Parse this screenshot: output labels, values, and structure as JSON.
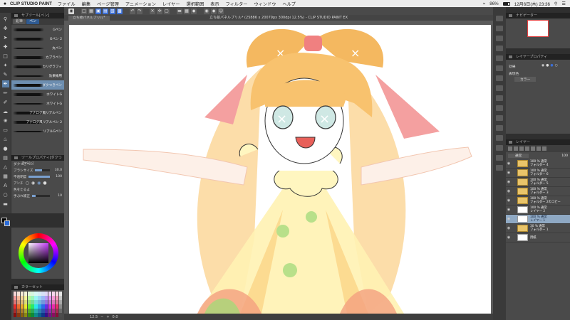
{
  "menubar": {
    "app_name": "CLIP STUDIO PAINT",
    "items": [
      "ファイル",
      "編集",
      "ページ管理",
      "アニメーション",
      "レイヤー",
      "選択範囲",
      "表示",
      "フィルター",
      "ウィンドウ",
      "ヘルプ"
    ],
    "battery": "86%",
    "clock": "12月6日(木) 23:36"
  },
  "document": {
    "tab_name": "立ち絵パネルプリル*",
    "title": "立ち絵パネルプリル* (25886 x 20079px 300dpi 12.5%) - CLIP STUDIO PAINT EX",
    "zoom": "12.5",
    "angle": "0.0"
  },
  "subtool": {
    "panel_title": "サブツール[ペン]",
    "tabs": [
      "鉛筆",
      "ペン"
    ],
    "brushes": [
      "Gペン",
      "Gペン 2",
      "丸ペン",
      "カブラペン",
      "カリグラフィ",
      "効果線用",
      "ダクつきペン",
      "ホワイトG",
      "ホワイトG",
      "アナログ風リアルペン",
      "アナログ風リアルペン 2",
      "リアルGペン"
    ],
    "selected_index": 6
  },
  "tool_property": {
    "panel_title": "ツールプロパティ[ダクつきペン]",
    "brush_name": "ダクつきペン",
    "brush_size_label": "ブラシサイズ",
    "brush_size_value": "30.0",
    "opacity_label": "不透明度",
    "opacity_value": "100",
    "anti_alias_label": "アンチ",
    "stabilization_label": "手ぶれ補正",
    "stabilization_value": "10",
    "color_tail_label": "色をたるよ",
    "brush_size_fraction": 0.45,
    "opacity_fraction": 1.0,
    "stabilization_fraction": 0.2
  },
  "color_set": {
    "panel_title": "カラーセット"
  },
  "navigator": {
    "panel_title": "ナビゲーター"
  },
  "layer_property": {
    "panel_title": "レイヤープロパティ",
    "effect_label": "効果",
    "expression_label": "表現色",
    "expression_value": "カラー"
  },
  "layers": {
    "panel_title": "レイヤー",
    "blend_mode": "通常",
    "opacity": "100",
    "items": [
      {
        "line1": "100 % 通常",
        "line2": "フォルダー 4",
        "type": "folder",
        "selected": false
      },
      {
        "line1": "100 % 通常",
        "line2": "フォルダー 6",
        "type": "folder",
        "selected": false
      },
      {
        "line1": "100 % 通常",
        "line2": "フォルダー 5",
        "type": "folder",
        "selected": false
      },
      {
        "line1": "100 % 通常",
        "line2": "フォルダー 3",
        "type": "folder",
        "selected": false
      },
      {
        "line1": "100 % 通常",
        "line2": "フォルダー 2のコピー",
        "type": "folder",
        "selected": false
      },
      {
        "line1": "100 % 通常",
        "line2": "レイヤー 2",
        "type": "layer",
        "selected": false
      },
      {
        "line1": "100 % 通常",
        "line2": "レイヤー 1",
        "type": "layer",
        "selected": true
      },
      {
        "line1": "30 % 通常",
        "line2": "フォルダー 1",
        "type": "folder",
        "selected": false
      },
      {
        "line1": "",
        "line2": "用紙",
        "type": "paper",
        "selected": false
      }
    ]
  },
  "colors": {
    "accent": "#3b6fd8",
    "selection": "#8fa9c4",
    "hair": "#f8c26e",
    "skin": "#fde8d8",
    "dress": "#fff2b3",
    "ribbon": "#f08080",
    "green": "#a8d878"
  }
}
